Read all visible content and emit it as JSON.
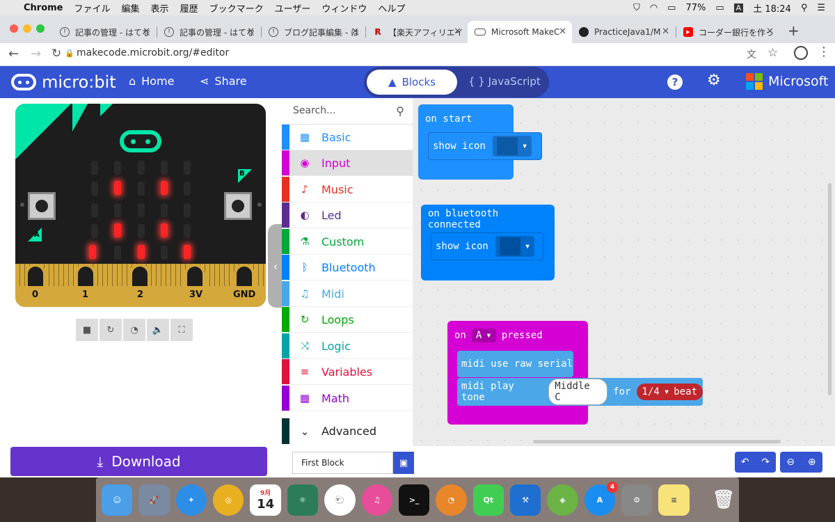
{
  "menubar": {
    "apple": "",
    "app": "Chrome",
    "items": [
      "ファイル",
      "編集",
      "表示",
      "履歴",
      "ブックマーク",
      "ユーザー",
      "ウィンドウ",
      "ヘルプ"
    ],
    "battery": "77%",
    "input_mode": "A",
    "clock": "土 18:24"
  },
  "tabs": [
    {
      "title": "記事の管理 - はてな"
    },
    {
      "title": "記事の管理 - はてな"
    },
    {
      "title": "ブログ記事編集 - は"
    },
    {
      "title": "【楽天アフィリエイ"
    },
    {
      "title": "Microsoft MakeC"
    },
    {
      "title": "PracticeJava1/M"
    },
    {
      "title": "コーダー銀行を作っ"
    }
  ],
  "address": {
    "url": "makecode.microbit.org/#editor"
  },
  "header": {
    "logo": "micro:bit",
    "home": "Home",
    "share": "Share",
    "blocks": "Blocks",
    "javascript": "JavaScript",
    "brand": "Microsoft"
  },
  "simulator": {
    "pins": [
      "0",
      "1",
      "2",
      "3V",
      "GND"
    ],
    "button_a": "A",
    "button_b": "B"
  },
  "toolbox": {
    "search_placeholder": "Search...",
    "categories": [
      {
        "label": "Basic",
        "color": "#1e90ff",
        "icon": "▦"
      },
      {
        "label": "Input",
        "color": "#d400d4",
        "icon": "◉"
      },
      {
        "label": "Music",
        "color": "#e63022",
        "icon": "🎧"
      },
      {
        "label": "Led",
        "color": "#5c2d91",
        "icon": "◐"
      },
      {
        "label": "Custom",
        "color": "#00a83a",
        "icon": "⚗"
      },
      {
        "label": "Bluetooth",
        "color": "#0082fb",
        "icon": "ᛒ"
      },
      {
        "label": "Midi",
        "color": "#4ba7e8",
        "icon": "♫"
      },
      {
        "label": "Loops",
        "color": "#00aa00",
        "icon": "↻"
      },
      {
        "label": "Logic",
        "color": "#00a4a6",
        "icon": "⤨"
      },
      {
        "label": "Variables",
        "color": "#dc143c",
        "icon": "≡"
      },
      {
        "label": "Math",
        "color": "#9400d3",
        "icon": "▦"
      }
    ],
    "advanced": "Advanced"
  },
  "blocks": {
    "on_start": "on start",
    "show_icon": "show icon",
    "on_bt": "on bluetooth connected",
    "on_button": "on",
    "button_val": "A",
    "pressed": "pressed",
    "midi_raw": "midi use raw serial",
    "midi_play": "midi play tone",
    "note": "Middle C",
    "for": "for",
    "beat_val": "1/4",
    "beat": "beat"
  },
  "bottom": {
    "download": "Download",
    "project": "First Block"
  },
  "dock": {
    "calendar_month": "9月",
    "calendar_day": "14",
    "appstore_badge": "4"
  }
}
